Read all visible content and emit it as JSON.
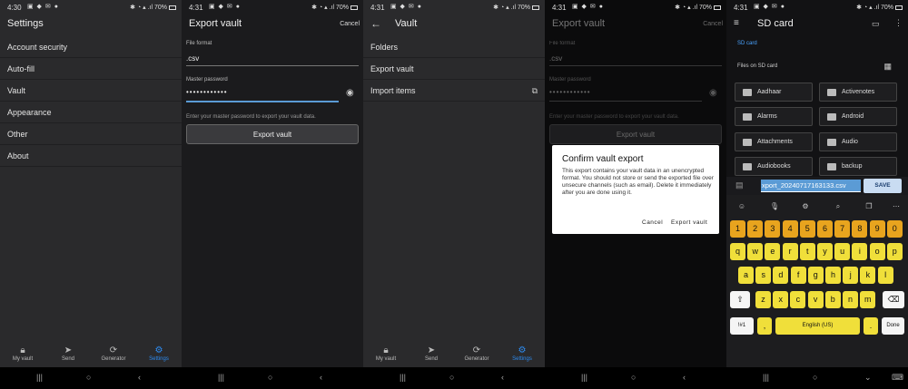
{
  "panels": [
    {
      "status": {
        "time": "4:30",
        "battery": "70%"
      },
      "title": "Settings",
      "menu": [
        "Account security",
        "Auto-fill",
        "Vault",
        "Appearance",
        "Other",
        "About"
      ],
      "nav": [
        "My vault",
        "Send",
        "Generator",
        "Settings"
      ]
    },
    {
      "status": {
        "time": "4:31",
        "battery": "70%"
      },
      "title": "Export vault",
      "cancel": "Cancel",
      "file_format_label": "File format",
      "file_format_value": ".csv",
      "master_password_label": "Master password",
      "master_password_value": "••••••••••••",
      "hint": "Enter your master password to export your vault data.",
      "export_button": "Export vault"
    },
    {
      "status": {
        "time": "4:31",
        "battery": "70%"
      },
      "title": "Vault",
      "menu": [
        "Folders",
        "Export vault",
        "Import items"
      ],
      "nav": [
        "My vault",
        "Send",
        "Generator",
        "Settings"
      ]
    },
    {
      "status": {
        "time": "4:31",
        "battery": "70%"
      },
      "title": "Export vault",
      "cancel": "Cancel",
      "file_format_label": "File format",
      "file_format_value": ".csv",
      "master_password_label": "Master password",
      "master_password_value": "••••••••••••",
      "hint": "Enter your master password to export your vault data.",
      "export_button": "Export vault",
      "dialog": {
        "title": "Confirm vault export",
        "body": "This export contains your vault data in an unencrypted format. You should not store or send the exported file over unsecure channels (such as email). Delete it immediately after you are done using it.",
        "cancel": "Cancel",
        "confirm": "Export vault"
      }
    },
    {
      "status": {
        "time": "4:31",
        "battery": "70%"
      },
      "title": "SD card",
      "crumb": "SD card",
      "files_label": "Files on SD card",
      "folders": [
        "Aadhaar",
        "Activenotes",
        "Alarms",
        "Android",
        "Attachments",
        "Audio",
        "Audiobooks",
        "backup"
      ],
      "filename": "xport_20240717163133.csv",
      "save": "SAVE",
      "keyboard": {
        "numbers": [
          "1",
          "2",
          "3",
          "4",
          "5",
          "6",
          "7",
          "8",
          "9",
          "0"
        ],
        "row1": [
          "q",
          "w",
          "e",
          "r",
          "t",
          "y",
          "u",
          "i",
          "o",
          "p"
        ],
        "row2": [
          "a",
          "s",
          "d",
          "f",
          "g",
          "h",
          "j",
          "k",
          "l"
        ],
        "row3": [
          "z",
          "x",
          "c",
          "v",
          "b",
          "n",
          "m"
        ],
        "symbols": "!#1",
        "comma": ",",
        "space": "English (US)",
        "period": ".",
        "done": "Done"
      }
    }
  ]
}
